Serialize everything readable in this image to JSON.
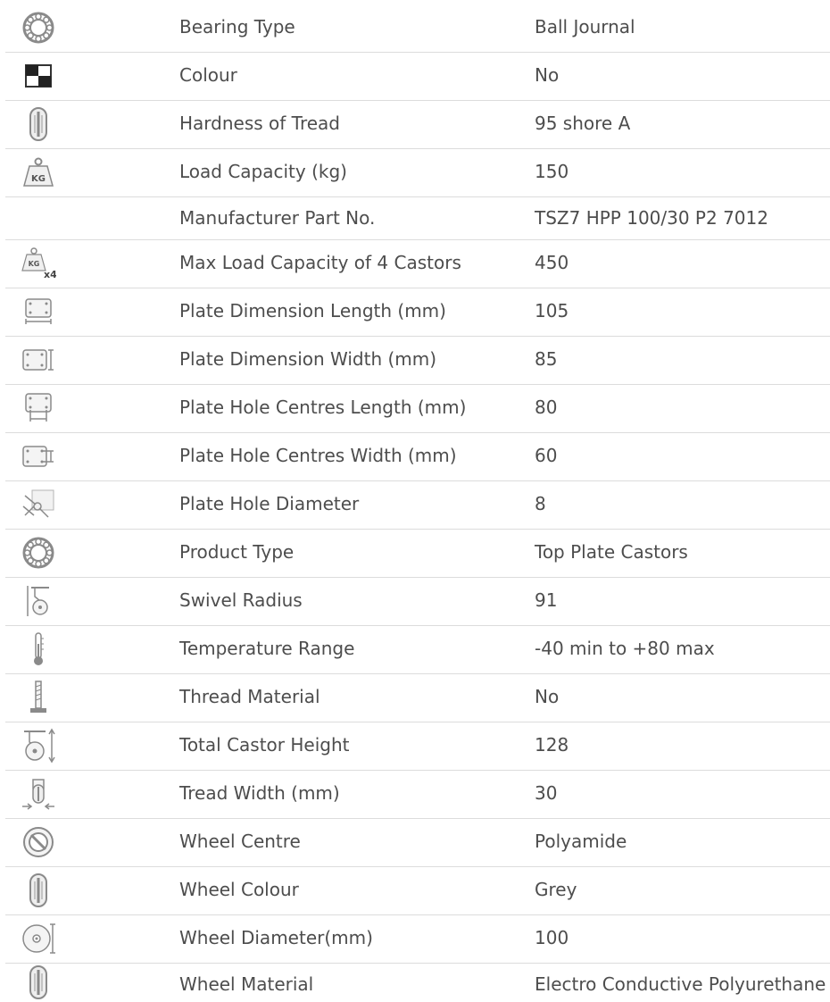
{
  "specifications": [
    {
      "icon": "bearing-icon",
      "label": "Bearing Type",
      "value": "Ball Journal"
    },
    {
      "icon": "colour-swatch-icon",
      "label": "Colour",
      "value": "No"
    },
    {
      "icon": "tread-hardness-icon",
      "label": "Hardness of Tread",
      "value": "95 shore A"
    },
    {
      "icon": "kg-weight-icon",
      "label": "Load Capacity (kg)",
      "value": "150"
    },
    {
      "icon": "",
      "label": "Manufacturer Part No.",
      "value": "TSZ7 HPP 100/30 P2 7012"
    },
    {
      "icon": "kg-weight-x4-icon",
      "label": "Max Load Capacity of 4 Castors",
      "value": "450"
    },
    {
      "icon": "plate-length-icon",
      "label": "Plate Dimension Length (mm)",
      "value": "105"
    },
    {
      "icon": "plate-width-icon",
      "label": "Plate Dimension Width (mm)",
      "value": "85"
    },
    {
      "icon": "plate-hole-length-icon",
      "label": "Plate Hole Centres Length (mm)",
      "value": "80"
    },
    {
      "icon": "plate-hole-width-icon",
      "label": "Plate Hole Centres Width (mm)",
      "value": "60"
    },
    {
      "icon": "hole-diameter-icon",
      "label": "Plate Hole Diameter",
      "value": "8"
    },
    {
      "icon": "bearing-icon",
      "label": "Product Type",
      "value": "Top Plate Castors"
    },
    {
      "icon": "swivel-radius-icon",
      "label": "Swivel Radius",
      "value": "91"
    },
    {
      "icon": "thermometer-icon",
      "label": "Temperature Range",
      "value": "-40 min to +80 max"
    },
    {
      "icon": "thread-icon",
      "label": "Thread Material",
      "value": "No"
    },
    {
      "icon": "castor-height-icon",
      "label": "Total Castor Height",
      "value": "128"
    },
    {
      "icon": "tread-width-icon",
      "label": "Tread Width (mm)",
      "value": "30"
    },
    {
      "icon": "wheel-centre-icon",
      "label": "Wheel Centre",
      "value": "Polyamide"
    },
    {
      "icon": "wheel-icon",
      "label": "Wheel Colour",
      "value": "Grey"
    },
    {
      "icon": "wheel-diameter-icon",
      "label": "Wheel Diameter(mm)",
      "value": "100"
    },
    {
      "icon": "wheel-icon",
      "label": "Wheel Material",
      "value": "Electro Conductive Polyurethane"
    }
  ]
}
